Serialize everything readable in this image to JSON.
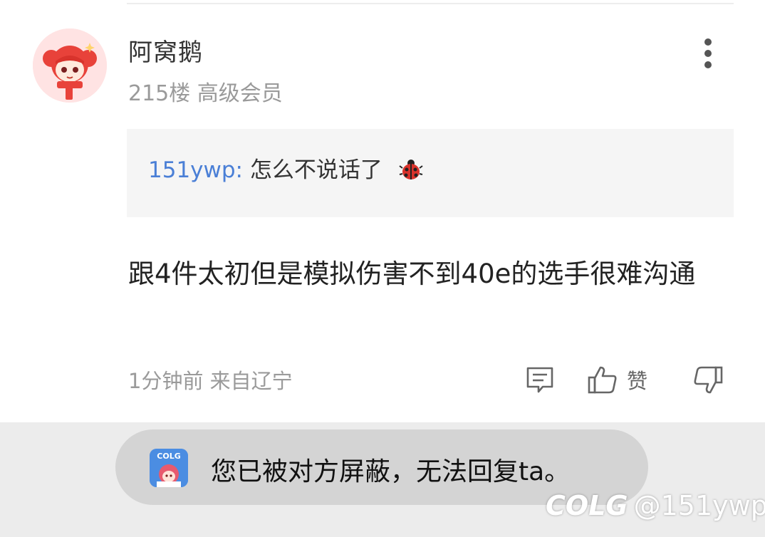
{
  "post": {
    "username": "阿窝鹅",
    "floor_info": "215楼 高级会员",
    "quote": {
      "user": "151ywp:",
      "text": "怎么不说话了"
    },
    "content": "跟4件太初但是模拟伤害不到40e的选手很难沟通",
    "time_location": "1分钟前 来自辽宁",
    "like_label": "赞"
  },
  "toast": {
    "message": "您已被对方屏蔽，无法回复ta。",
    "icon_text": "COLG"
  },
  "watermark": {
    "logo": "COLG",
    "handle": "@151ywp"
  },
  "colors": {
    "link_blue": "#4a7fd6",
    "quote_bg": "#f5f5f5",
    "meta_gray": "#9a9a9a",
    "toast_bg": "#d4d4d4"
  },
  "icons": [
    "avatar",
    "more-vertical-icon",
    "ladybug-icon",
    "comment-icon",
    "thumbs-up-icon",
    "thumbs-down-icon",
    "colg-app-icon"
  ]
}
